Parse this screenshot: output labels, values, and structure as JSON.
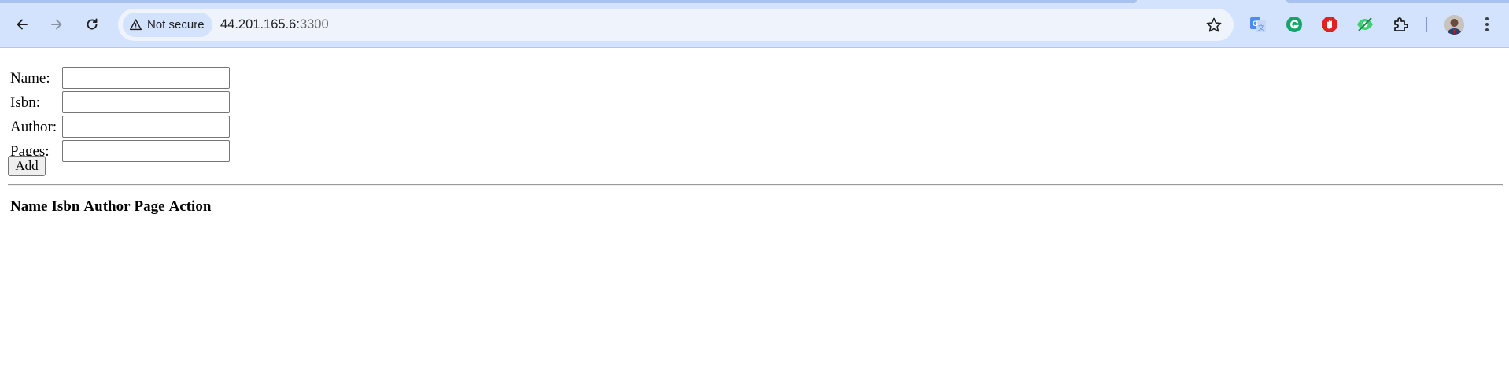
{
  "browser": {
    "security_label": "Not secure",
    "url_host": "44.201.165.6:",
    "url_port": "3300",
    "icons": [
      "back-arrow-icon",
      "forward-arrow-icon",
      "reload-icon",
      "warning-icon",
      "bookmark-star-icon",
      "google-translate-icon",
      "grammarly-icon",
      "adblock-icon",
      "eye-extension-icon",
      "extensions-puzzle-icon",
      "profile-avatar",
      "more-menu-icon"
    ],
    "colors": {
      "toolbar": "#d3e3fd",
      "omnibox": "#eef3fc",
      "grammarly": "#15a56b",
      "adblock": "#e02222",
      "translate": "#4c8bf5"
    }
  },
  "form": {
    "fields": [
      {
        "label": "Name:",
        "value": ""
      },
      {
        "label": "Isbn:",
        "value": ""
      },
      {
        "label": "Author:",
        "value": ""
      },
      {
        "label": "Pages:",
        "value": ""
      }
    ],
    "add_label": "Add"
  },
  "table": {
    "headers": [
      "Name",
      "Isbn",
      "Author",
      "Page",
      "Action"
    ],
    "rows": []
  }
}
